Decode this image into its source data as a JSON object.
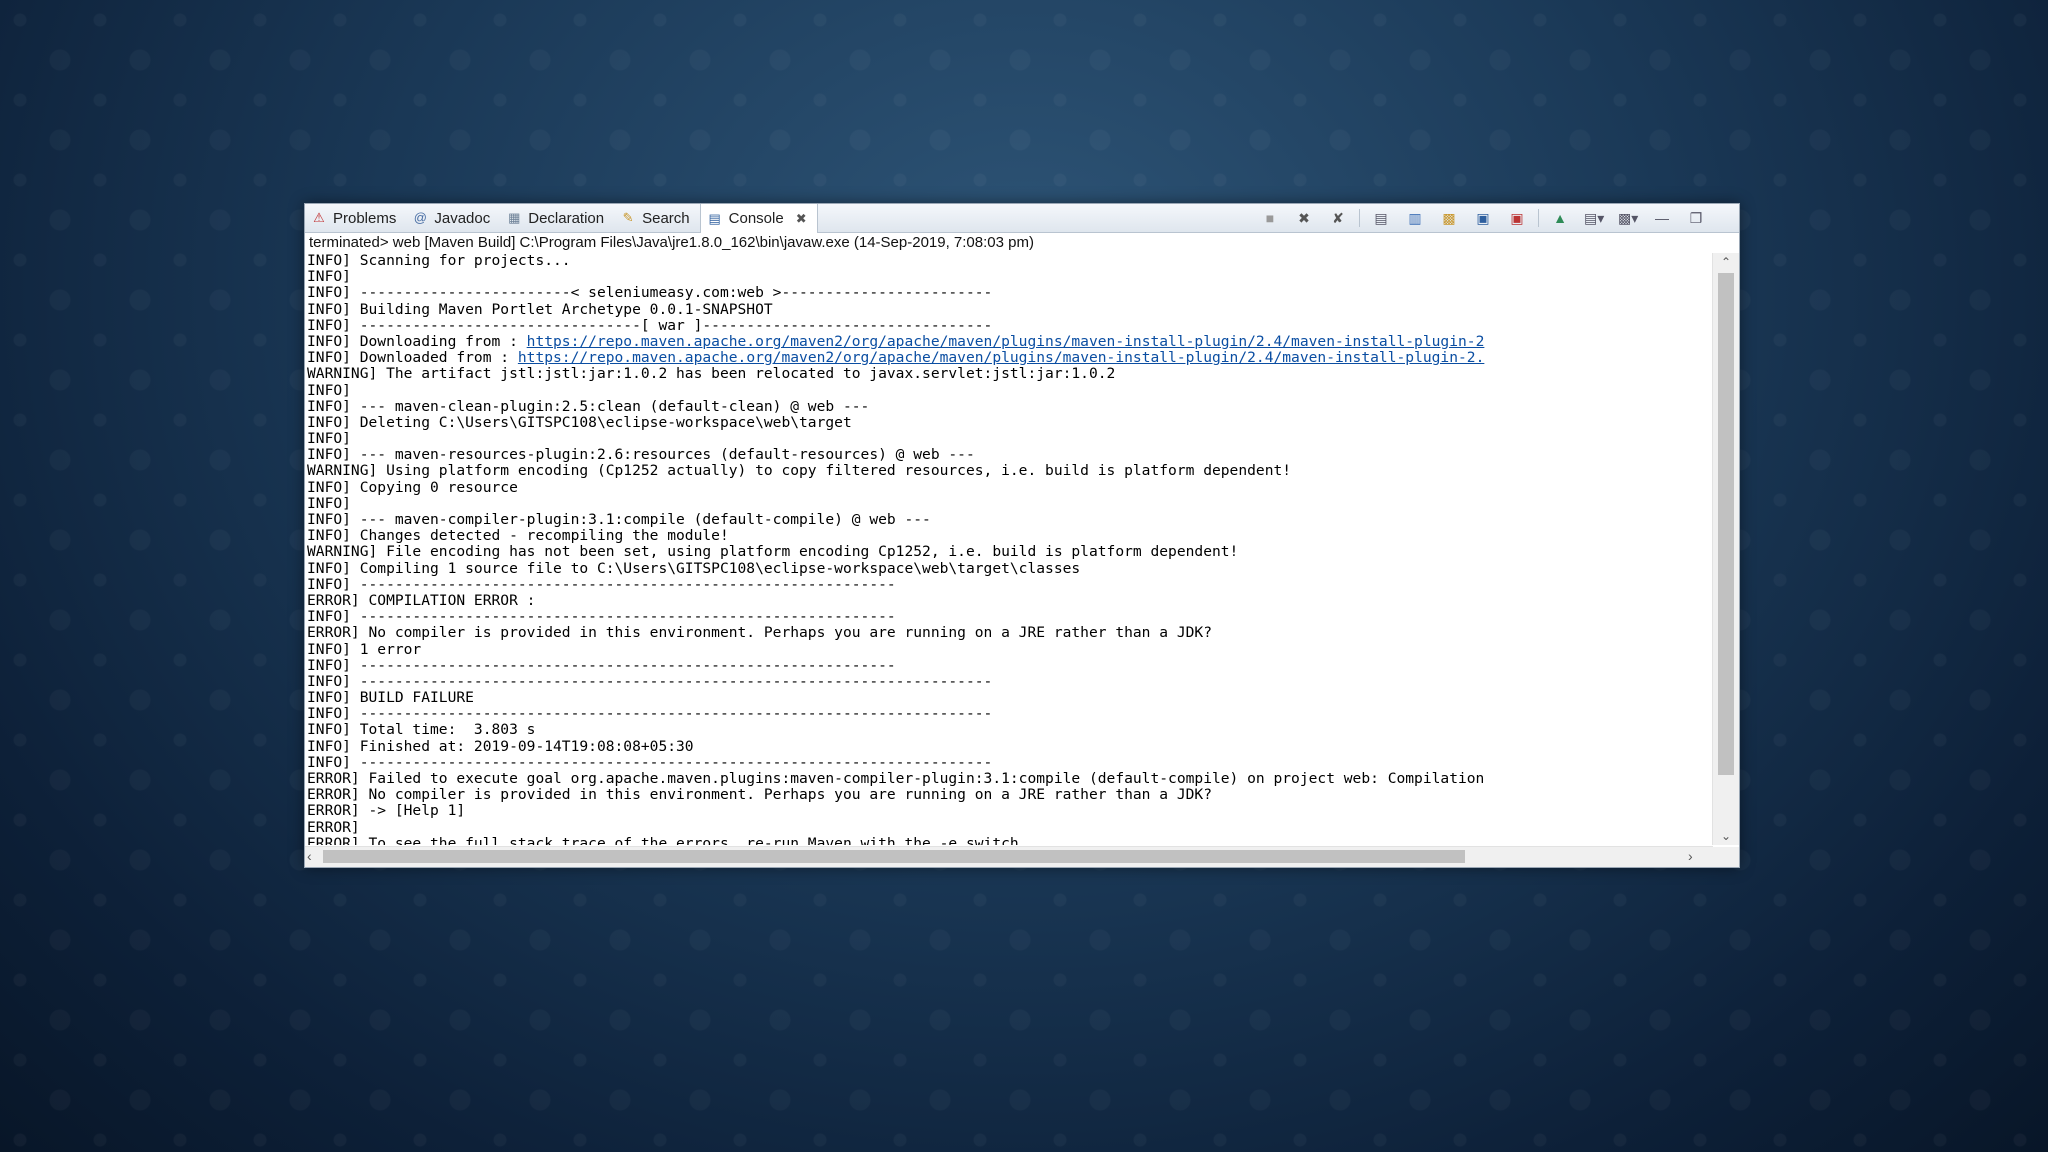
{
  "tabs": [
    {
      "label": "Problems",
      "icon": "problems-icon"
    },
    {
      "label": "Javadoc",
      "icon": "javadoc-icon"
    },
    {
      "label": "Declaration",
      "icon": "declaration-icon"
    },
    {
      "label": "Search",
      "icon": "search-icon"
    },
    {
      "label": "Console",
      "icon": "console-icon",
      "active": true
    }
  ],
  "console_status": "terminated> web [Maven Build] C:\\Program Files\\Java\\jre1.8.0_162\\bin\\javaw.exe (14-Sep-2019, 7:08:03 pm)",
  "console_lines": [
    {
      "text": "INFO] Scanning for projects..."
    },
    {
      "text": "INFO]"
    },
    {
      "text": "INFO] ------------------------< seleniumeasy.com:web >------------------------"
    },
    {
      "text": "INFO] Building Maven Portlet Archetype 0.0.1-SNAPSHOT"
    },
    {
      "text": "INFO] --------------------------------[ war ]---------------------------------"
    },
    {
      "text": "INFO] Downloading from : ",
      "link": "https://repo.maven.apache.org/maven2/org/apache/maven/plugins/maven-install-plugin/2.4/maven-install-plugin-2"
    },
    {
      "text": "INFO] Downloaded from : ",
      "link": "https://repo.maven.apache.org/maven2/org/apache/maven/plugins/maven-install-plugin/2.4/maven-install-plugin-2."
    },
    {
      "text": "WARNING] The artifact jstl:jstl:jar:1.0.2 has been relocated to javax.servlet:jstl:jar:1.0.2"
    },
    {
      "text": "INFO]"
    },
    {
      "text": "INFO] --- maven-clean-plugin:2.5:clean (default-clean) @ web ---"
    },
    {
      "text": "INFO] Deleting C:\\Users\\GITSPC108\\eclipse-workspace\\web\\target"
    },
    {
      "text": "INFO]"
    },
    {
      "text": "INFO] --- maven-resources-plugin:2.6:resources (default-resources) @ web ---"
    },
    {
      "text": "WARNING] Using platform encoding (Cp1252 actually) to copy filtered resources, i.e. build is platform dependent!"
    },
    {
      "text": "INFO] Copying 0 resource"
    },
    {
      "text": "INFO]"
    },
    {
      "text": "INFO] --- maven-compiler-plugin:3.1:compile (default-compile) @ web ---"
    },
    {
      "text": "INFO] Changes detected - recompiling the module!"
    },
    {
      "text": "WARNING] File encoding has not been set, using platform encoding Cp1252, i.e. build is platform dependent!"
    },
    {
      "text": "INFO] Compiling 1 source file to C:\\Users\\GITSPC108\\eclipse-workspace\\web\\target\\classes"
    },
    {
      "text": "INFO] -------------------------------------------------------------"
    },
    {
      "text": "ERROR] COMPILATION ERROR :"
    },
    {
      "text": "INFO] -------------------------------------------------------------"
    },
    {
      "text": "ERROR] No compiler is provided in this environment. Perhaps you are running on a JRE rather than a JDK?"
    },
    {
      "text": "INFO] 1 error"
    },
    {
      "text": "INFO] -------------------------------------------------------------"
    },
    {
      "text": "INFO] ------------------------------------------------------------------------"
    },
    {
      "text": "INFO] BUILD FAILURE"
    },
    {
      "text": "INFO] ------------------------------------------------------------------------"
    },
    {
      "text": "INFO] Total time:  3.803 s"
    },
    {
      "text": "INFO] Finished at: 2019-09-14T19:08:08+05:30"
    },
    {
      "text": "INFO] ------------------------------------------------------------------------"
    },
    {
      "text": "ERROR] Failed to execute goal org.apache.maven.plugins:maven-compiler-plugin:3.1:compile (default-compile) on project web: Compilation"
    },
    {
      "text": "ERROR] No compiler is provided in this environment. Perhaps you are running on a JRE rather than a JDK?"
    },
    {
      "text": "ERROR] -> [Help 1]"
    },
    {
      "text": "ERROR]"
    },
    {
      "text": "ERROR] To see the full stack trace of the errors, re-run Maven with the -e switch."
    }
  ],
  "toolbar_icons": [
    "terminate-icon",
    "remove-launch-icon",
    "remove-all-terminated-icon",
    "scroll-lock-icon",
    "word-wrap-icon",
    "show-console-icon",
    "pin-console-icon",
    "display-selected-console-icon",
    "new-console-icon",
    "open-console-icon",
    "minimize-icon",
    "maximize-icon"
  ]
}
